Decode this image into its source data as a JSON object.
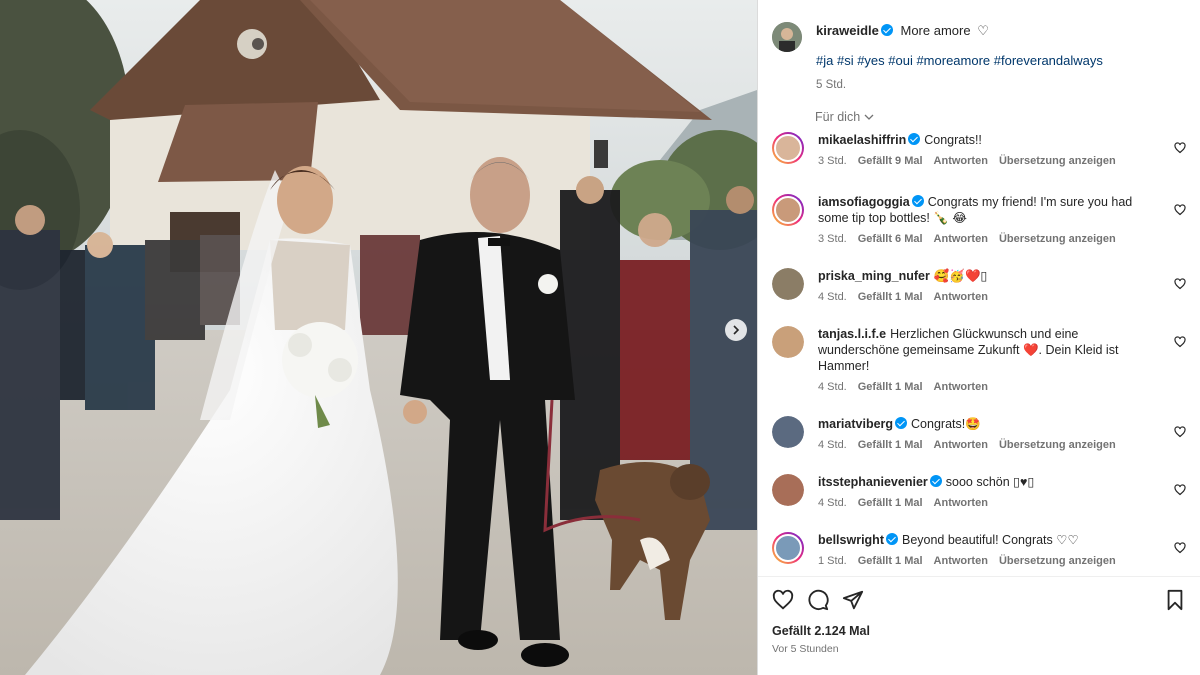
{
  "post": {
    "author": "kiraweidle",
    "caption_text": "More amore",
    "hashtags": "#ja #si #yes #oui #moreamore #foreverandalways",
    "caption_time": "5 Std.",
    "filter_label": "Für dich",
    "likes_text": "Gefällt 2.124 Mal",
    "posted_when": "Vor 5 Stunden"
  },
  "colors": {
    "link": "#00376b",
    "verified": "#0095f6",
    "heart": "#ed4956",
    "muted": "#737373"
  },
  "comments": [
    {
      "user": "mikaelashiffrin",
      "verified": true,
      "text": "Congrats!!",
      "time": "3 Std.",
      "likes": "Gefällt 9 Mal",
      "reply": "Antworten",
      "translate": "Übersetzung anzeigen"
    },
    {
      "user": "iamsofiagoggia",
      "verified": true,
      "text": "Congrats my friend! I'm sure you had some tip top bottles! 🍾 😂",
      "time": "3 Std.",
      "likes": "Gefällt 6 Mal",
      "reply": "Antworten",
      "translate": "Übersetzung anzeigen"
    },
    {
      "user": "priska_ming_nufer",
      "verified": false,
      "text": "🥰🥳❤️▯",
      "time": "4 Std.",
      "likes": "Gefällt 1 Mal",
      "reply": "Antworten",
      "translate": ""
    },
    {
      "user": "tanjas.l.i.f.e",
      "verified": false,
      "text": "Herzlichen Glückwunsch und eine wunderschöne gemeinsame Zukunft ❤️. Dein Kleid ist Hammer!",
      "time": "4 Std.",
      "likes": "Gefällt 1 Mal",
      "reply": "Antworten",
      "translate": ""
    },
    {
      "user": "mariatviberg",
      "verified": true,
      "text": "Congrats!🤩",
      "time": "4 Std.",
      "likes": "Gefällt 1 Mal",
      "reply": "Antworten",
      "translate": "Übersetzung anzeigen"
    },
    {
      "user": "itsstephanievenier",
      "verified": true,
      "text": "sooo schön ▯♥▯",
      "time": "4 Std.",
      "likes": "Gefällt 1 Mal",
      "reply": "Antworten",
      "translate": ""
    },
    {
      "user": "bellswright",
      "verified": true,
      "text": "Beyond beautiful! Congrats ♡♡",
      "time": "1 Std.",
      "likes": "Gefällt 1 Mal",
      "reply": "Antworten",
      "translate": "Übersetzung anzeigen"
    }
  ],
  "icons": {
    "like": "heart-outline-icon",
    "comment": "speech-bubble-icon",
    "share": "paper-plane-icon",
    "save": "bookmark-icon",
    "next": "chevron-right-icon"
  }
}
